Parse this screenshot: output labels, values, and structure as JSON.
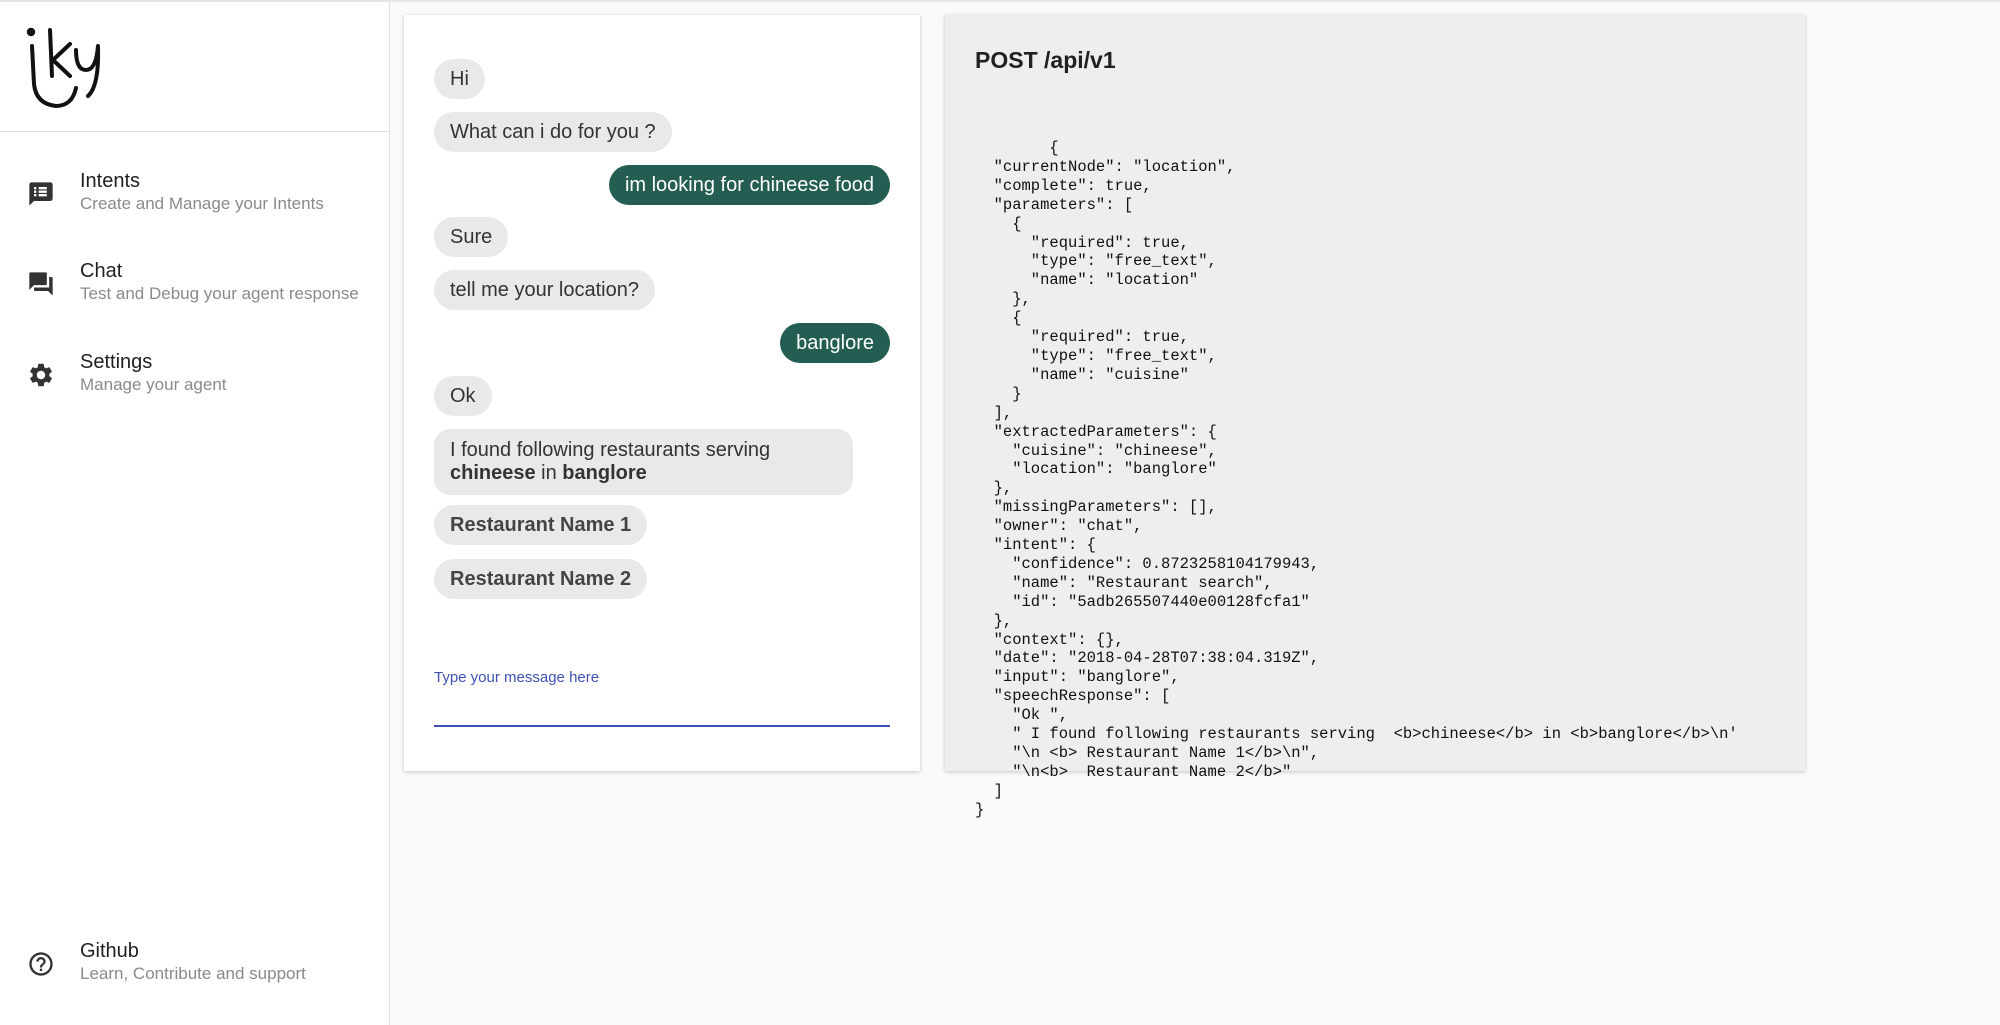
{
  "sidebar": {
    "logo_text": "iKY",
    "items": [
      {
        "icon": "list-icon",
        "label": "Intents",
        "sublabel": "Create and Manage your Intents"
      },
      {
        "icon": "forum-icon",
        "label": "Chat",
        "sublabel": "Test and Debug your agent response"
      },
      {
        "icon": "gear-icon",
        "label": "Settings",
        "sublabel": "Manage your agent"
      }
    ],
    "footer": {
      "icon": "help-circle-icon",
      "label": "Github",
      "sublabel": "Learn, Contribute and support"
    }
  },
  "chat": {
    "messages": [
      {
        "from": "bot",
        "text": "Hi"
      },
      {
        "from": "bot",
        "text": "What can i do for you ?"
      },
      {
        "from": "user",
        "text": "im looking for chineese food"
      },
      {
        "from": "bot",
        "text": "Sure"
      },
      {
        "from": "bot",
        "text": "tell me your location?"
      },
      {
        "from": "user",
        "text": "banglore"
      },
      {
        "from": "bot",
        "text": "Ok"
      },
      {
        "from": "bot",
        "line1": "I found following restaurants serving",
        "bold1": "chineese",
        "mid": " in ",
        "bold2": "banglore"
      },
      {
        "from": "bot",
        "text": "Restaurant Name 1"
      },
      {
        "from": "bot",
        "text": "Restaurant Name 2"
      }
    ],
    "input": {
      "label": "Type your message here",
      "value": ""
    }
  },
  "api": {
    "title": "POST /api/v1",
    "response": "        {\n  \"currentNode\": \"location\",\n  \"complete\": true,\n  \"parameters\": [\n    {\n      \"required\": true,\n      \"type\": \"free_text\",\n      \"name\": \"location\"\n    },\n    {\n      \"required\": true,\n      \"type\": \"free_text\",\n      \"name\": \"cuisine\"\n    }\n  ],\n  \"extractedParameters\": {\n    \"cuisine\": \"chineese\",\n    \"location\": \"banglore\"\n  },\n  \"missingParameters\": [],\n  \"owner\": \"chat\",\n  \"intent\": {\n    \"confidence\": 0.8723258104179943,\n    \"name\": \"Restaurant search\",\n    \"id\": \"5adb265507440e00128fcfa1\"\n  },\n  \"context\": {},\n  \"date\": \"2018-04-28T07:38:04.319Z\",\n  \"input\": \"banglore\",\n  \"speechResponse\": [\n    \"Ok \",\n    \" I found following restaurants serving  <b>chineese</b> in <b>banglore</b>\\n'\n    \"\\n <b> Restaurant Name 1</b>\\n\",\n    \"\\n<b>  Restaurant Name 2</b>\"\n  ]\n}"
  },
  "colors": {
    "user_bubble": "#245d51",
    "bot_bubble": "#e9e9e9",
    "accent": "#3f51b5",
    "json_bg": "#eeeeee"
  }
}
